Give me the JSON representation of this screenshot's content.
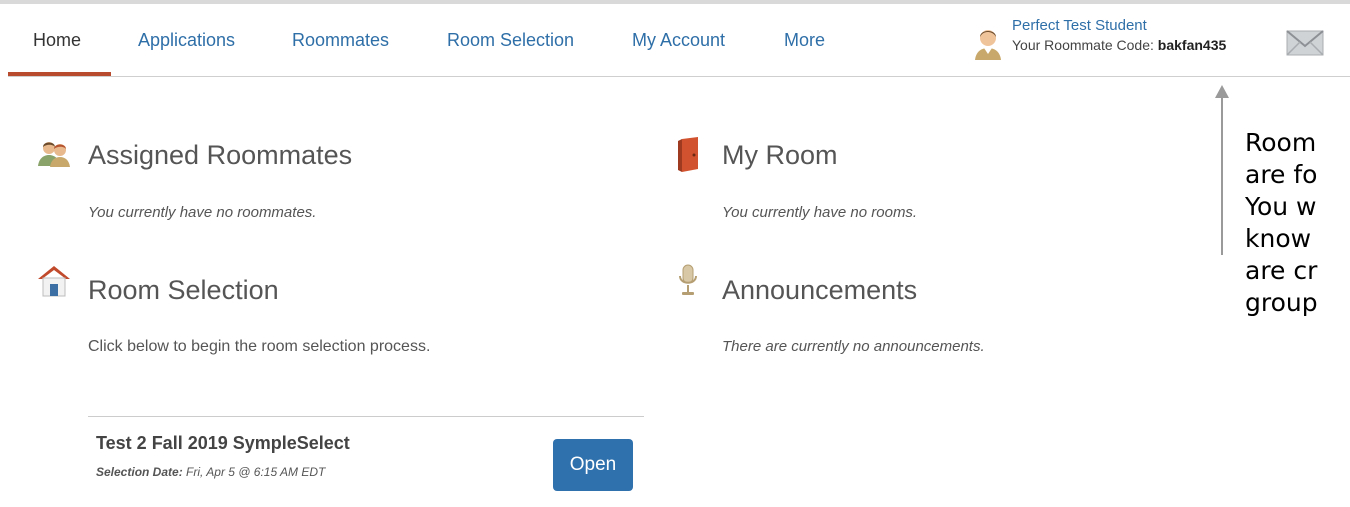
{
  "nav": {
    "items": [
      {
        "label": "Home"
      },
      {
        "label": "Applications"
      },
      {
        "label": "Roommates"
      },
      {
        "label": "Room Selection"
      },
      {
        "label": "My Account"
      },
      {
        "label": "More"
      }
    ],
    "active": "Home"
  },
  "user": {
    "name": "Perfect Test Student",
    "code_label": "Your Roommate Code:",
    "code": "bakfan435",
    "avatar_icon": "student-avatar-icon",
    "mail_icon": "envelope-icon"
  },
  "sections": {
    "assigned_roommates": {
      "title": "Assigned Roommates",
      "text": "You currently have no roommates.",
      "icon": "roommates-icon"
    },
    "my_room": {
      "title": "My Room",
      "text": "You currently have no rooms.",
      "icon": "door-icon"
    },
    "room_selection": {
      "title": "Room Selection",
      "text": "Click below to begin the room selection process.",
      "icon": "house-icon"
    },
    "announcements": {
      "title": "Announcements",
      "text": "There are currently no announcements.",
      "icon": "microphone-icon"
    }
  },
  "selection": {
    "title": "Test 2 Fall 2019 SympleSelect",
    "date_label": "Selection Date:",
    "date_value": "Fri, Apr 5 @ 6:15 AM EDT",
    "button": "Open"
  },
  "callout": {
    "text": "Room\nare fo\nYou w\nknow \nare cr\ngroup"
  },
  "colors": {
    "link": "#2f6fa8",
    "active_underline": "#b84a2e",
    "button": "#2f71ad"
  }
}
